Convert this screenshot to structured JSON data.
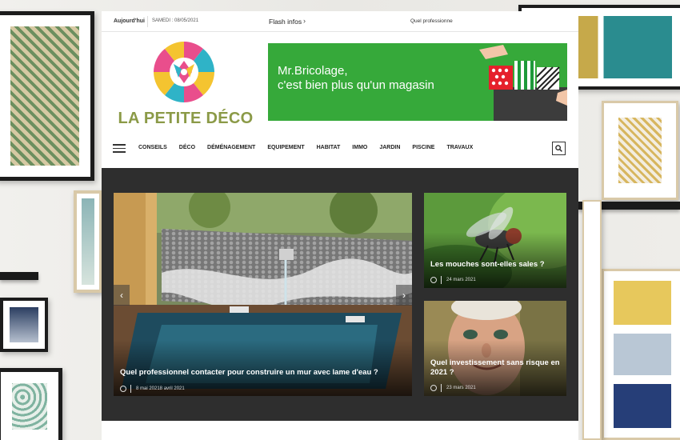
{
  "topbar": {
    "today_label": "Aujourd'hui",
    "date": "SAMEDI : 08/05/2021",
    "flash_label": "Flash infos",
    "flash_arrow": "›",
    "ticker_text": "Quel professionne"
  },
  "site": {
    "logo_text": "LA PETITE DÉCO"
  },
  "ad": {
    "line1": "Mr.Bricolage,",
    "line2": "c'est bien plus qu'un magasin"
  },
  "nav": {
    "items": [
      "CONSEILS",
      "DÉCO",
      "DÉMÉNAGEMENT",
      "EQUIPEMENT",
      "HABITAT",
      "IMMO",
      "JARDIN",
      "PISCINE",
      "TRAVAUX"
    ]
  },
  "featured": {
    "main": {
      "title": "Quel professionnel contacter pour construire un mur avec lame d'eau ?",
      "meta": "8 mai 20218 avril 2021"
    },
    "side1": {
      "title": "Les mouches sont-elles sales ?",
      "meta": "24 mars 2021"
    },
    "side2": {
      "title": "Quel investissement sans risque en 2021 ?",
      "meta": "23 mars 2021"
    },
    "prev_arrow": "‹",
    "next_arrow": "›"
  },
  "colors": {
    "logo_green": "#8b9a47",
    "ad_green": "#36a93a",
    "dark_panel": "#2e2e2e"
  }
}
